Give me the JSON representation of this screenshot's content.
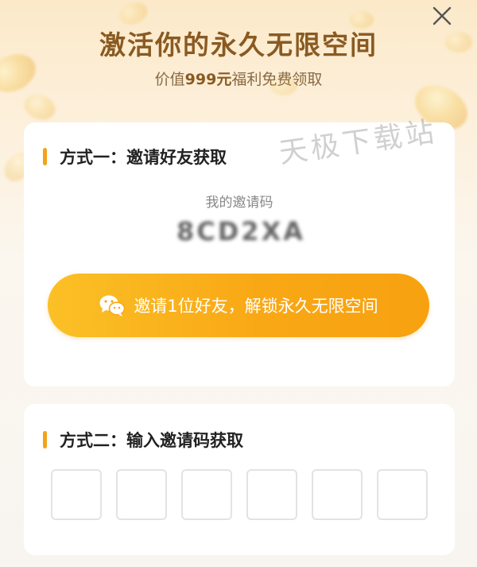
{
  "header": {
    "title": "激活你的永久无限空间",
    "subtitle_prefix": "价值",
    "subtitle_value": "999元",
    "subtitle_suffix": "福利免费领取"
  },
  "watermark": "天极下载站",
  "method1": {
    "title": "方式一：邀请好友获取",
    "invite_code_label": "我的邀请码",
    "invite_code": "8CD2XA",
    "button_label": "邀请1位好友，解锁永久无限空间",
    "button_icon": "wechat-icon"
  },
  "method2": {
    "title": "方式二：输入邀请码获取",
    "code_boxes": [
      "",
      "",
      "",
      "",
      "",
      ""
    ]
  },
  "colors": {
    "accent": "#f4a21a",
    "title": "#8a5a22",
    "button_start": "#fbc026",
    "button_end": "#f7a110"
  }
}
